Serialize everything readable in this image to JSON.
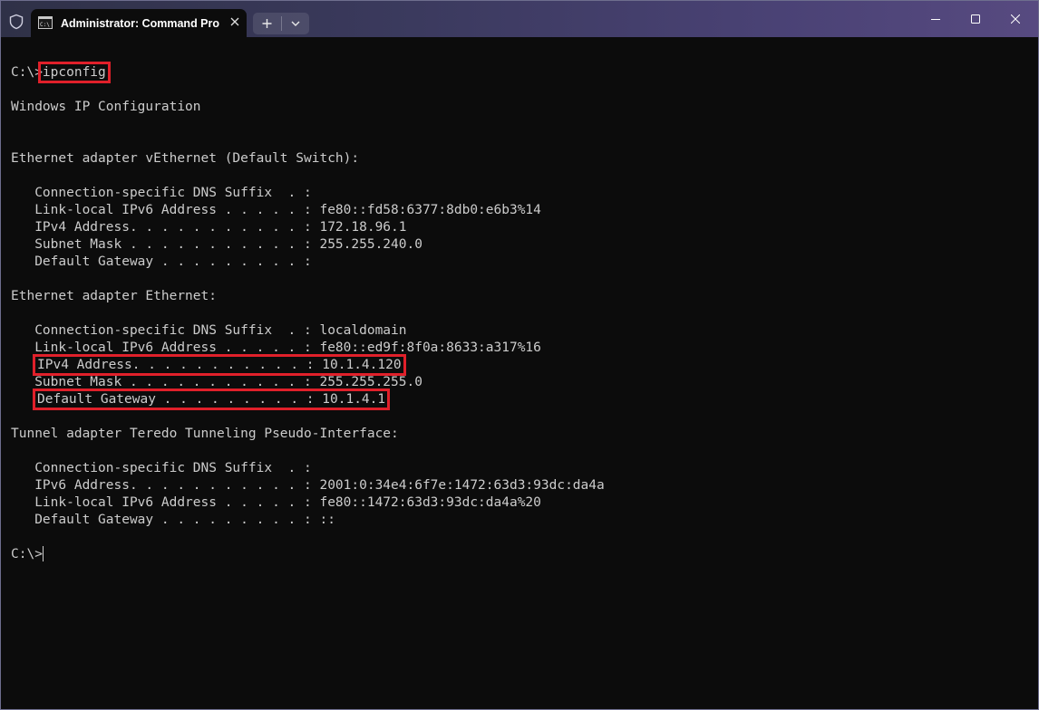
{
  "window": {
    "tab_title": "Administrator: Command Pro",
    "title_icon": "cmd-icon",
    "shield_icon": "shield-icon",
    "new_tab_icon": "plus-icon",
    "dropdown_icon": "chevron-down-icon",
    "controls": [
      "minimize-icon",
      "maximize-icon",
      "close-icon"
    ]
  },
  "colors": {
    "background": "#0c0c0c",
    "text": "#cccccc",
    "highlight_box": "#e0202a"
  },
  "console": {
    "prompt1": "C:\\>",
    "command": "ipconfig",
    "header": "Windows IP Configuration",
    "adapter1": {
      "title": "Ethernet adapter vEthernet (Default Switch):",
      "dns": "   Connection-specific DNS Suffix  . :",
      "ipv6": "   Link-local IPv6 Address . . . . . : fe80::fd58:6377:8db0:e6b3%14",
      "ipv4": "   IPv4 Address. . . . . . . . . . . : 172.18.96.1",
      "mask": "   Subnet Mask . . . . . . . . . . . : 255.255.240.0",
      "gateway": "   Default Gateway . . . . . . . . . :"
    },
    "adapter2": {
      "title": "Ethernet adapter Ethernet:",
      "dns": "   Connection-specific DNS Suffix  . : localdomain",
      "ipv6": "   Link-local IPv6 Address . . . . . : fe80::ed9f:8f0a:8633:a317%16",
      "ipv4": "IPv4 Address. . . . . . . . . . . : 10.1.4.120",
      "mask": "   Subnet Mask . . . . . . . . . . . : 255.255.255.0",
      "gateway": "Default Gateway . . . . . . . . . : 10.1.4.1"
    },
    "adapter3": {
      "title": "Tunnel adapter Teredo Tunneling Pseudo-Interface:",
      "dns": "   Connection-specific DNS Suffix  . :",
      "ipv6": "   IPv6 Address. . . . . . . . . . . : 2001:0:34e4:6f7e:1472:63d3:93dc:da4a",
      "ipv6_local": "   Link-local IPv6 Address . . . . . : fe80::1472:63d3:93dc:da4a%20",
      "gateway": "   Default Gateway . . . . . . . . . : ::"
    },
    "prompt2": "C:\\>"
  }
}
